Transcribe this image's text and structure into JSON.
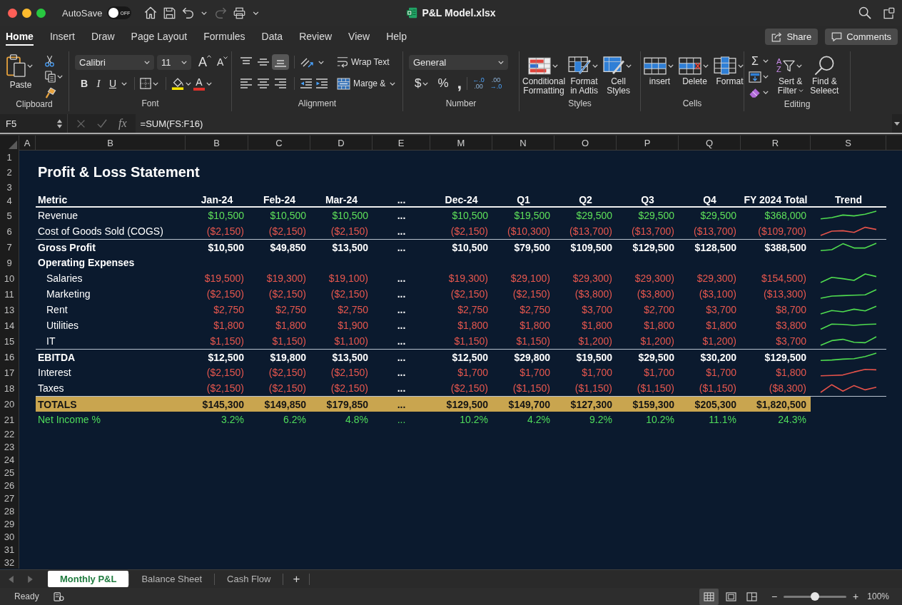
{
  "window": {
    "title": "P&L Model.xlsx",
    "autosave": {
      "label": "AutoSave",
      "on": false,
      "state_text": "OFF"
    }
  },
  "ribbon_tabs": [
    {
      "label": "Home",
      "selected": true
    },
    {
      "label": "Insert",
      "selected": false
    },
    {
      "label": "Draw",
      "selected": false
    },
    {
      "label": "Page Layout",
      "selected": false
    },
    {
      "label": "Formules",
      "selected": false
    },
    {
      "label": "Data",
      "selected": false
    },
    {
      "label": "Review",
      "selected": false
    },
    {
      "label": "View",
      "selected": false
    },
    {
      "label": "Help",
      "selected": false
    }
  ],
  "ribbon_actions": {
    "share_label": "Share",
    "comments_label": "Comments"
  },
  "ribbon": {
    "clipboard": {
      "title": "Clipboard",
      "paste_label": "Paste"
    },
    "font": {
      "title": "Font",
      "font_name": "Calibri",
      "font_size": "11",
      "grow_label": "A",
      "shrink_label": "A",
      "style_buttons": [
        {
          "kind": "bold",
          "label": "B"
        },
        {
          "kind": "italic",
          "label": "I"
        },
        {
          "kind": "underline",
          "label": "U"
        }
      ],
      "font_color_label": "A"
    },
    "alignment": {
      "title": "Alignment",
      "vertical": [
        {
          "kind": "top",
          "selected": false
        },
        {
          "kind": "middle",
          "selected": false
        },
        {
          "kind": "bottom",
          "selected": true
        }
      ],
      "horizontal": [
        {
          "kind": "left",
          "selected": false
        },
        {
          "kind": "center",
          "selected": false
        },
        {
          "kind": "right",
          "selected": false
        }
      ],
      "wrap_label": "Wrap Text",
      "merge_label": "Marge &"
    },
    "number": {
      "title": "Number",
      "format": "General",
      "currency_label": "$",
      "percent_label": "%",
      "comma_label": ",",
      "decimal_buttons": [
        {
          "kind": "increase",
          "top": "←.0",
          "bottom": ".00"
        },
        {
          "kind": "decrease",
          "top": ".00",
          "bottom": "→.0"
        }
      ]
    },
    "styles": {
      "title": "Styles",
      "buttons": [
        {
          "kind": "conditional",
          "label": "Conditional\nFormatting"
        },
        {
          "kind": "table",
          "label": "Format\nin Adtis"
        },
        {
          "kind": "cell_styles",
          "label": "Cell\nStyles"
        }
      ]
    },
    "cells": {
      "title": "Cells",
      "buttons": [
        {
          "kind": "insert",
          "label": "insert"
        },
        {
          "kind": "delete",
          "label": "Delete"
        },
        {
          "kind": "format",
          "label": "Format"
        }
      ]
    },
    "editing": {
      "title": "Editing",
      "autosum_label": "Σ",
      "sort_letters": [
        "A",
        "Z"
      ],
      "sort_label": "Sert &\nFilter",
      "find_label": "Find &\nSeleect"
    }
  },
  "formula_bar": {
    "name_box": "F5",
    "fx_label": "fx",
    "formula": "=SUM(FS:F16)"
  },
  "sheet": {
    "column_headers": [
      "A",
      "B",
      "B",
      "C",
      "D",
      "E",
      "M",
      "N",
      "O",
      "P",
      "Q",
      "R",
      "S"
    ],
    "rows": [
      {
        "number": "1",
        "kind": "blank"
      },
      {
        "number": "2",
        "kind": "title",
        "label": "Profit & Loss Statement"
      },
      {
        "number": "3",
        "kind": "blank"
      },
      {
        "number": "4",
        "kind": "header",
        "label": "Metric",
        "values": [
          "Jan-24",
          "Feb-24",
          "Mar-24",
          "...",
          "Dec-24",
          "Q1",
          "Q2",
          "Q3",
          "Q4",
          "FY 2024 Total",
          "Trend"
        ]
      },
      {
        "number": "5",
        "kind": "positive",
        "label": "Revenue",
        "values": [
          "$10,500",
          "$10,500",
          "$10,500",
          "...",
          "$10,500",
          "$19,500",
          "$29,500",
          "$29,500",
          "$29,500",
          "$368,000"
        ],
        "trend": {
          "color": "#4fdc4f"
        }
      },
      {
        "number": "6",
        "kind": "negative",
        "label": "Cost of Goods Sold (COGS)",
        "values": [
          "($2,150)",
          "($2,150)",
          "($2,150)",
          "...",
          "($2,150)",
          "($10,300)",
          "($13,700)",
          "($13,700)",
          "($13,700)",
          "($109,700)"
        ],
        "trend": {
          "color": "#e4524a"
        }
      },
      {
        "number": "7",
        "kind": "subtotal",
        "label": "Gross Profit",
        "values": [
          "$10,500",
          "$49,850",
          "$13,500",
          "...",
          "$10,500",
          "$79,500",
          "$109,500",
          "$129,500",
          "$128,500",
          "$388,500"
        ],
        "trend": {
          "color": "#4fdc4f"
        }
      },
      {
        "number": "9",
        "kind": "section",
        "label": "Operating Expenses",
        "children": [
          {
            "number": "10",
            "kind": "negative",
            "label": "Salaries",
            "values": [
              "$19,500)",
              "$19,300)",
              "$19,100)",
              "...",
              "$19,300)",
              "$29,100)",
              "$29,300)",
              "$29,300)",
              "$29,300)",
              "$154,500)"
            ],
            "trend": {
              "color": "#4fdc4f"
            }
          },
          {
            "number": "11",
            "kind": "negative",
            "label": "Marketing",
            "values": [
              "($2,150)",
              "($2,150)",
              "($2,150)",
              "...",
              "($2,150)",
              "($2,150)",
              "($3,800)",
              "($3,800)",
              "($3,100)",
              "($13,300)"
            ],
            "trend": {
              "color": "#4fdc4f"
            }
          },
          {
            "number": "13",
            "kind": "negative",
            "label": "Rent",
            "values": [
              "$2,750",
              "$2,750",
              "$2,750",
              "...",
              "$2,750",
              "$2,750",
              "$3,700",
              "$2,700",
              "$3,700",
              "$8,700"
            ],
            "trend": {
              "color": "#4fdc4f"
            }
          },
          {
            "number": "14",
            "kind": "negative",
            "label": "Utilities",
            "values": [
              "$1,800",
              "$1,800",
              "$1,900",
              "...",
              "$1,800",
              "$1,800",
              "$1,800",
              "$1,800",
              "$1,800",
              "$3,800"
            ],
            "trend": {
              "color": "#4fdc4f"
            }
          },
          {
            "number": "15",
            "kind": "negative",
            "label": "IT",
            "values": [
              "$1,150)",
              "$1,150)",
              "$1,100)",
              "...",
              "$1,150)",
              "$1,150)",
              "$1,200)",
              "$1,200)",
              "$1,200)",
              "$3,700"
            ],
            "trend": {
              "color": "#4fdc4f"
            }
          }
        ]
      },
      {
        "number": "16",
        "kind": "subtotal",
        "label": "EBITDA",
        "values": [
          "$12,500",
          "$19,800",
          "$13,500",
          "...",
          "$12,500",
          "$29,800",
          "$19,500",
          "$29,500",
          "$30,200",
          "$129,500"
        ],
        "trend": {
          "color": "#4fdc4f"
        }
      },
      {
        "number": "17",
        "kind": "negative",
        "label": "Interest",
        "values": [
          "($2,150)",
          "($2,150)",
          "($2,150)",
          "...",
          "$1,700",
          "$1,700",
          "$1,700",
          "$1,700",
          "$1,700",
          "$1,800"
        ],
        "trend": {
          "color": "#e4524a"
        }
      },
      {
        "number": "18",
        "kind": "negative",
        "label": "Taxes",
        "values": [
          "($2,150)",
          "($2,150)",
          "($2,150)",
          "...",
          "($2,150)",
          "($1,150)",
          "($1,150)",
          "($1,150)",
          "($1,150)",
          "($8,300)"
        ],
        "trend": {
          "color": "#e4524a"
        }
      },
      {
        "number": "20",
        "kind": "totals",
        "label": "TOTALS",
        "values": [
          "$145,300",
          "$149,850",
          "$179,850",
          "...",
          "$129,500",
          "$149,700",
          "$127,300",
          "$159,300",
          "$205,300",
          "$1,820,500"
        ]
      },
      {
        "number": "21",
        "kind": "ratio",
        "label": "Net Income %",
        "values": [
          "3.2%",
          "6.2%",
          "4.8%",
          "...",
          "10.2%",
          "4.2%",
          "9.2%",
          "10.2%",
          "11.1%",
          "24.3%"
        ]
      },
      {
        "number": "22",
        "kind": "blank"
      },
      {
        "number": "23",
        "kind": "blank"
      },
      {
        "number": "24",
        "kind": "blank"
      },
      {
        "number": "25",
        "kind": "blank"
      },
      {
        "number": "26",
        "kind": "blank"
      },
      {
        "number": "27",
        "kind": "blank"
      },
      {
        "number": "28",
        "kind": "blank"
      },
      {
        "number": "29",
        "kind": "blank"
      },
      {
        "number": "30",
        "kind": "blank"
      },
      {
        "number": "31",
        "kind": "blank"
      },
      {
        "number": "32",
        "kind": "blank"
      }
    ]
  },
  "sheet_tabs": [
    {
      "label": "Monthly P&L",
      "selected": true
    },
    {
      "label": "Balance Sheet",
      "selected": false
    },
    {
      "label": "Cash Flow",
      "selected": false
    }
  ],
  "add_sheet_label": "+",
  "status_bar": {
    "status": "Ready",
    "views": [
      {
        "kind": "normal",
        "selected": true
      },
      {
        "kind": "page_layout",
        "selected": false
      },
      {
        "kind": "page_break",
        "selected": false
      }
    ],
    "zoom": {
      "minus_label": "−",
      "plus_label": "+",
      "level": 0.5,
      "reading": "100%"
    }
  }
}
